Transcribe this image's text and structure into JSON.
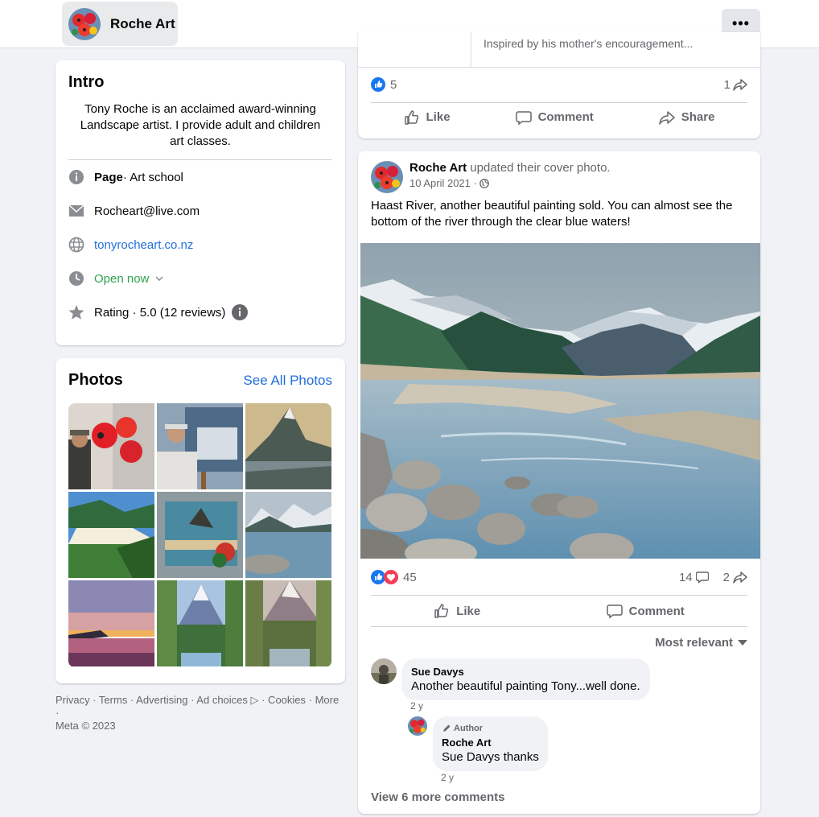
{
  "header": {
    "page_name": "Roche Art",
    "more_label": "•••"
  },
  "intro": {
    "title": "Intro",
    "bio": "Tony Roche is an acclaimed award-winning Landscape artist. I provide adult and children art classes.",
    "page_label": "Page",
    "category": " · Art school",
    "email": "Rocheart@live.com",
    "website": "tonyrocheart.co.nz",
    "hours": "Open now",
    "rating": "Rating · 5.0 (12 reviews)"
  },
  "photos": {
    "title": "Photos",
    "see_all": "See All Photos"
  },
  "footer": {
    "line1": "Privacy · Terms · Advertising · Ad choices ▷ · Cookies · More ·",
    "line2": "Meta © 2023"
  },
  "post1": {
    "truncated_text": "Inspired by his mother's encouragement...",
    "reactions": "5",
    "shares": "1",
    "like": "Like",
    "comment": "Comment",
    "share": "Share"
  },
  "post2": {
    "author": "Roche Art",
    "action": " updated their cover photo.",
    "date": "10 April 2021 ·",
    "text": "Haast River, another beautiful painting sold. You can almost see the bottom of the river through the clear blue waters!",
    "reactions": "45",
    "comments_count": "14",
    "shares": "2",
    "like": "Like",
    "comment": "Comment",
    "sort": "Most relevant",
    "comments": [
      {
        "name": "Sue Davys",
        "text": "Another beautiful painting Tony...well done.",
        "time": "2 y"
      },
      {
        "badge": "Author",
        "name": "Roche Art",
        "text": "Sue Davys thanks",
        "time": "2 y"
      }
    ],
    "view_more": "View 6 more comments"
  },
  "colors": {
    "link": "#216fdb",
    "open": "#31a24c",
    "like_blue": "#1877f2",
    "love_red": "#f33e58"
  }
}
